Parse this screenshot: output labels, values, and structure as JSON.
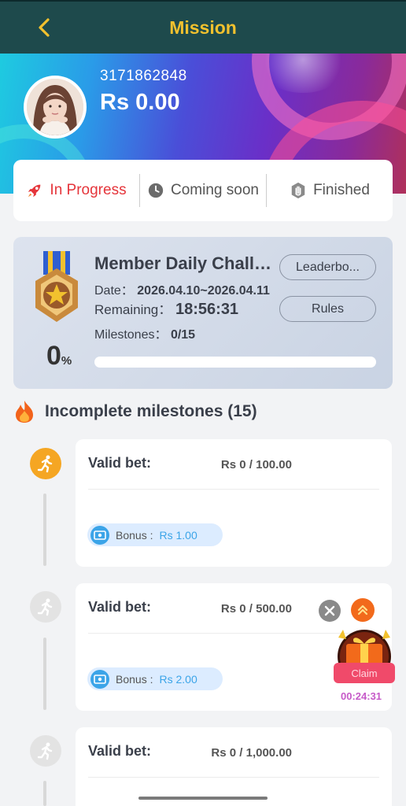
{
  "header": {
    "title": "Mission"
  },
  "user": {
    "id": "3171862848",
    "balance": "Rs 0.00"
  },
  "tabs": [
    {
      "label": "In Progress",
      "icon": "rocket-icon",
      "active": true
    },
    {
      "label": "Coming soon",
      "icon": "clock-icon",
      "active": false
    },
    {
      "label": "Finished",
      "icon": "hand-icon",
      "active": false
    }
  ],
  "challenge": {
    "name": "Member Daily Challen...",
    "date_label": "Date：",
    "date_value": "2026.04.10~2026.04.11",
    "remaining_label": "Remaining：",
    "remaining_value": "18:56:31",
    "milestones_label": "Milestones：",
    "milestones_value": "0/15",
    "progress_number": "0",
    "progress_unit": "%",
    "progress_fraction": 0,
    "leaderboard_label": "Leaderbo...",
    "rules_label": "Rules"
  },
  "section": {
    "title": "Incomplete milestones (15)"
  },
  "milestones": [
    {
      "label": "Valid bet:",
      "amount": "Rs 0 / 100.00",
      "bonus_label": "Bonus :",
      "bonus_value": "Rs 1.00",
      "active": true
    },
    {
      "label": "Valid bet:",
      "amount": "Rs 0 / 500.00",
      "bonus_label": "Bonus :",
      "bonus_value": "Rs 2.00",
      "active": false
    },
    {
      "label": "Valid bet:",
      "amount": "Rs 0 / 1,000.00",
      "bonus_label": "",
      "bonus_value": "",
      "active": false
    }
  ],
  "floating": {
    "claim_label": "Claim",
    "timer": "00:24:31"
  },
  "colors": {
    "header_bg": "#1e4a4c",
    "accent_gold": "#f2c12e",
    "active_tab": "#e5353b",
    "bonus_blue": "#3ba4e8",
    "step_active": "#f5a623"
  }
}
